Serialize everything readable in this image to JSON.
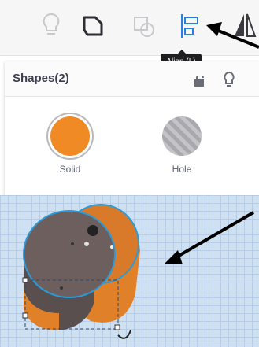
{
  "toolbar": {
    "tooltip": "Align (L)",
    "icons": [
      "note-icon",
      "group-icon",
      "ungroup-icon",
      "align-icon",
      "mirror-icon"
    ]
  },
  "panel": {
    "title": "Shapes(2)",
    "solid_label": "Solid",
    "hole_label": "Hole"
  },
  "colors": {
    "solid": "#f08a24",
    "align_active": "#2a7de1",
    "cylinder_top": "#6e5f5f",
    "selection": "#2a9bd8"
  }
}
